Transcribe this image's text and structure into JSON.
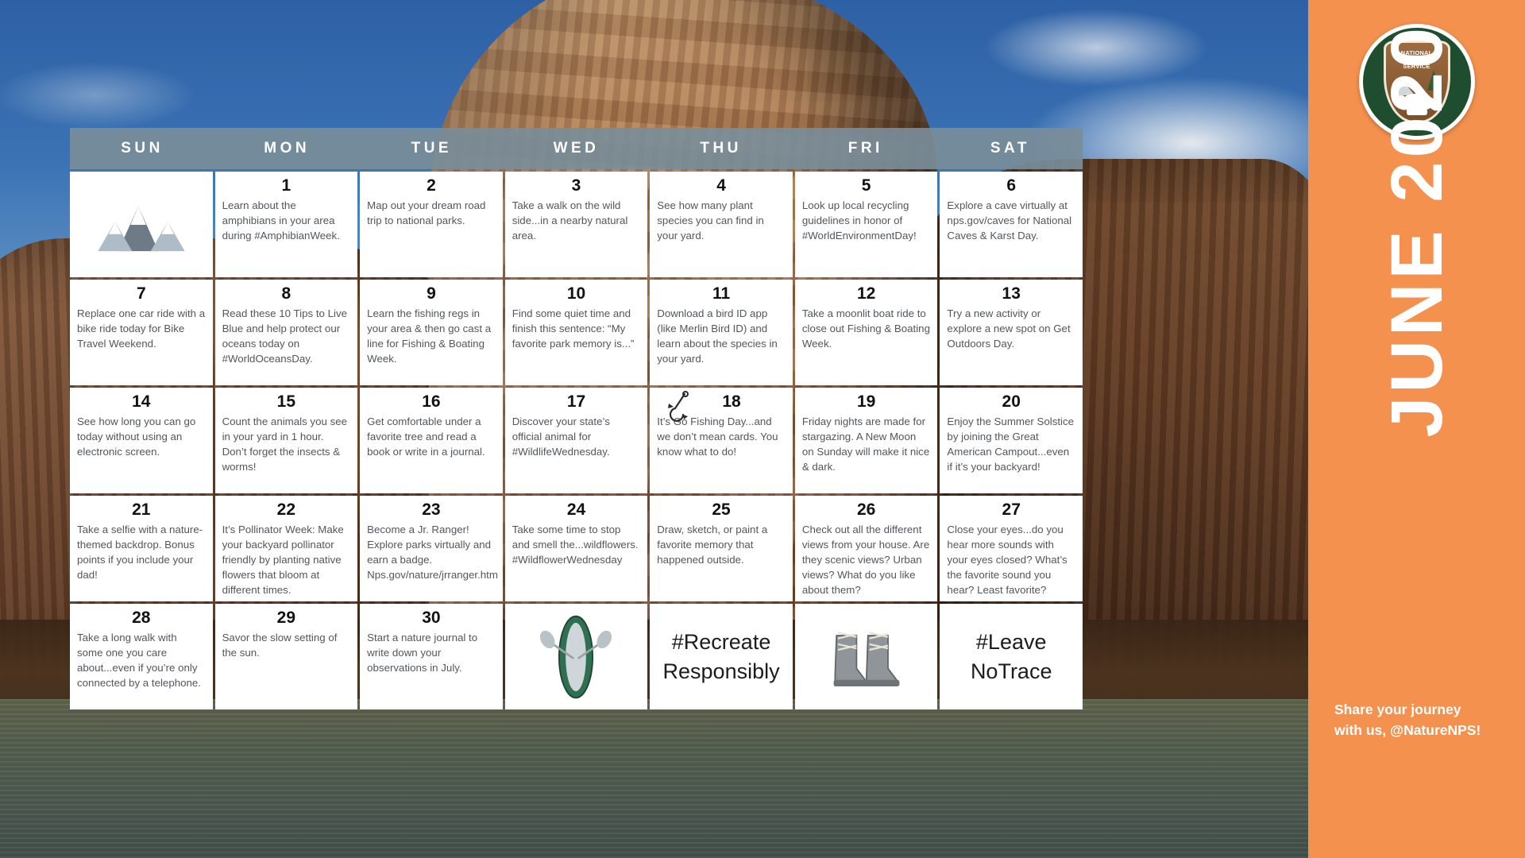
{
  "sidebar": {
    "logo_name": "National Park Service arrowhead logo",
    "logo_text_line1": "NATIONAL",
    "logo_text_line2": "PARK",
    "logo_text_line3": "SERVICE",
    "month_title": "JUNE 2020",
    "footer_line1": "Share your journey",
    "footer_line2": "with us, @NatureNPS!",
    "accent_color": "#f5914e"
  },
  "calendar": {
    "day_headers": [
      "SUN",
      "MON",
      "TUE",
      "WED",
      "THU",
      "FRI",
      "SAT"
    ],
    "header_bg": "#798d99",
    "weeks": [
      [
        {
          "kind": "art",
          "art": "mountains-illustration"
        },
        {
          "kind": "day",
          "num": "1",
          "text": "Learn about the amphibians in your area during #AmphibianWeek."
        },
        {
          "kind": "day",
          "num": "2",
          "text": "Map out your dream road trip to national parks."
        },
        {
          "kind": "day",
          "num": "3",
          "text": "Take a walk on the wild side...in a nearby natural area."
        },
        {
          "kind": "day",
          "num": "4",
          "text": "See how many plant species you can find in your yard."
        },
        {
          "kind": "day",
          "num": "5",
          "text": "Look up local recycling guidelines in honor of #WorldEnvironmentDay!"
        },
        {
          "kind": "day",
          "num": "6",
          "text": "Explore a cave  virtually at nps.gov/caves for National Caves & Karst Day."
        }
      ],
      [
        {
          "kind": "day",
          "num": "7",
          "text": "Replace one car ride with a bike ride today for Bike Travel Weekend."
        },
        {
          "kind": "day",
          "num": "8",
          "text": "Read these 10 Tips to Live Blue and help protect our oceans today on #WorldOceansDay."
        },
        {
          "kind": "day",
          "num": "9",
          "text": "Learn the fishing regs in your area & then go cast a line for Fishing & Boating Week."
        },
        {
          "kind": "day",
          "num": "10",
          "text": "Find some quiet time and finish this sentence: “My favorite park memory is...”"
        },
        {
          "kind": "day",
          "num": "11",
          "text": "Download a bird ID app (like Merlin Bird ID) and learn about the species in your yard."
        },
        {
          "kind": "day",
          "num": "12",
          "text": "Take a moonlit boat ride to close out Fishing & Boating Week."
        },
        {
          "kind": "day",
          "num": "13",
          "text": "Try a new activity or explore a new spot on Get Outdoors Day."
        }
      ],
      [
        {
          "kind": "day",
          "num": "14",
          "text": "See how long you can go today without using an electronic screen."
        },
        {
          "kind": "day",
          "num": "15",
          "text": "Count the animals you see in your yard in 1 hour. Don’t forget the insects & worms!"
        },
        {
          "kind": "day",
          "num": "16",
          "text": "Get comfortable under a favorite tree and read a book or write in a journal."
        },
        {
          "kind": "day",
          "num": "17",
          "text": "Discover your state’s official animal for #WildlifeWednesday."
        },
        {
          "kind": "day",
          "num": "18",
          "text": "It’s Go Fishing Day...and we don’t mean cards. You know what to do!",
          "icon": "fish-hook-icon"
        },
        {
          "kind": "day",
          "num": "19",
          "text": "Friday nights are made for stargazing. A New Moon on Sunday will make it nice & dark."
        },
        {
          "kind": "day",
          "num": "20",
          "text": "Enjoy the Summer Solstice by joining the Great American Campout...even if it’s your backyard!"
        }
      ],
      [
        {
          "kind": "day",
          "num": "21",
          "text": "Take a selfie with a nature-themed backdrop. Bonus points if you include your dad!"
        },
        {
          "kind": "day",
          "num": "22",
          "text": "It’s Pollinator Week: Make your backyard pollinator friendly by planting native flowers that bloom at different times."
        },
        {
          "kind": "day",
          "num": "23",
          "text": "Become a Jr. Ranger! Explore parks virtually and earn a badge. Nps.gov/nature/jrranger.htm"
        },
        {
          "kind": "day",
          "num": "24",
          "text": "Take some time to stop and smell the...wildflowers. #WildflowerWednesday"
        },
        {
          "kind": "day",
          "num": "25",
          "text": "Draw, sketch, or paint a favorite memory that happened outside."
        },
        {
          "kind": "day",
          "num": "26",
          "text": "Check out all the different views from your house. Are they scenic views? Urban views?  What do you like about them?"
        },
        {
          "kind": "day",
          "num": "27",
          "text": "Close your eyes...do you hear more sounds with your eyes closed? What’s the favorite sound you hear? Least favorite?"
        }
      ],
      [
        {
          "kind": "day",
          "num": "28",
          "text": "Take a long walk with some one you care about...even if you’re only connected by a telephone."
        },
        {
          "kind": "day",
          "num": "29",
          "text": "Savor the slow setting of the sun."
        },
        {
          "kind": "day",
          "num": "30",
          "text": "Start a nature journal to write down your observations in July."
        },
        {
          "kind": "art",
          "art": "canoe-paddle-illustration"
        },
        {
          "kind": "hashtag",
          "text": "#Recreate Responsibly"
        },
        {
          "kind": "art",
          "art": "hiking-boots-illustration"
        },
        {
          "kind": "hashtag",
          "text": "#Leave NoTrace"
        }
      ]
    ]
  }
}
